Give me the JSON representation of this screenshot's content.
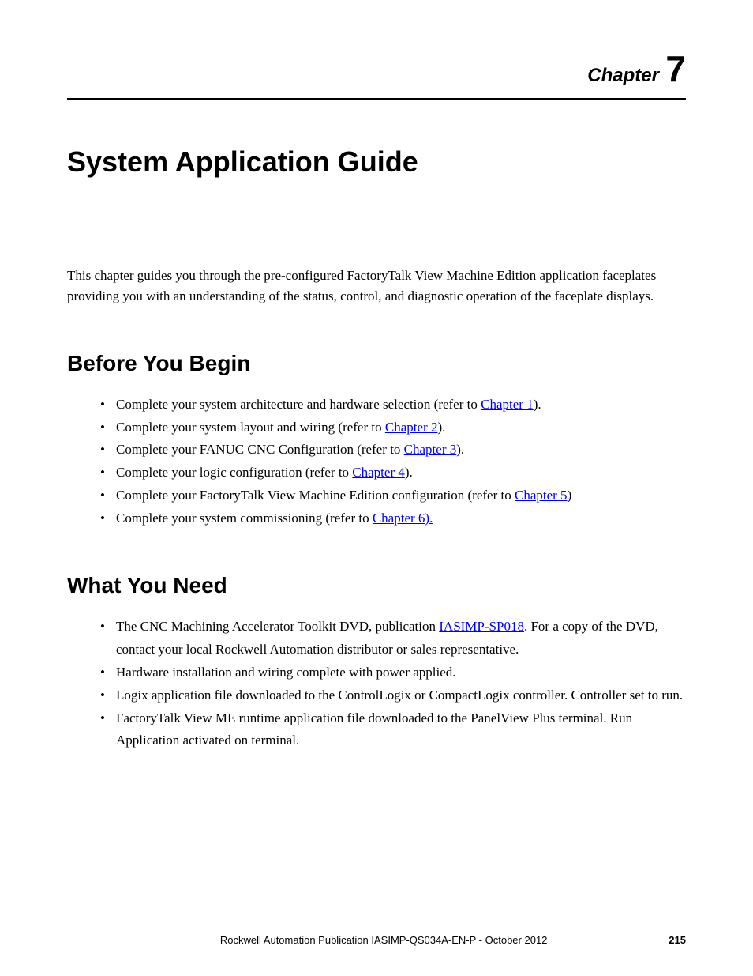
{
  "chapter": {
    "label": "Chapter",
    "number": "7"
  },
  "title": "System Application Guide",
  "intro": "This chapter guides you through the pre-configured FactoryTalk View Machine Edition application faceplates providing you with an understanding of the status, control, and diagnostic operation of the faceplate displays.",
  "sections": {
    "before_you_begin": {
      "heading": "Before You Begin",
      "items": [
        {
          "text_before": "Complete your system architecture and hardware selection (refer to ",
          "link": "Chapter 1",
          "text_after": ")."
        },
        {
          "text_before": "Complete your system layout and wiring (refer to ",
          "link": "Chapter 2",
          "text_after": ")."
        },
        {
          "text_before": "Complete your FANUC CNC Configuration (refer to ",
          "link": "Chapter 3",
          "text_after": ")."
        },
        {
          "text_before": "Complete your logic configuration (refer to ",
          "link": "Chapter 4",
          "text_after": ")."
        },
        {
          "text_before": "Complete your FactoryTalk View Machine Edition configuration (refer to ",
          "link": "Chapter 5",
          "text_after": ")"
        },
        {
          "text_before": "Complete your system commissioning (refer to ",
          "link": "Chapter 6).",
          "text_after": ""
        }
      ]
    },
    "what_you_need": {
      "heading": "What You Need",
      "items": [
        {
          "text_before": "The CNC Machining Accelerator Toolkit DVD, publication ",
          "link": "IASIMP-SP018",
          "text_after": ". For a copy of the DVD, contact your local Rockwell Automation distributor or sales representative."
        },
        {
          "text_before": "Hardware installation and wiring complete with power applied.",
          "link": "",
          "text_after": ""
        },
        {
          "text_before": "Logix application file downloaded to the ControlLogix or CompactLogix controller. Controller set to run.",
          "link": "",
          "text_after": ""
        },
        {
          "text_before": "FactoryTalk View ME runtime application file downloaded to the PanelView Plus terminal. Run Application activated on terminal.",
          "link": "",
          "text_after": ""
        }
      ]
    }
  },
  "footer": {
    "publication": "Rockwell Automation Publication IASIMP-QS034A-EN-P - ",
    "date": "October 2012",
    "pageno": "215"
  }
}
